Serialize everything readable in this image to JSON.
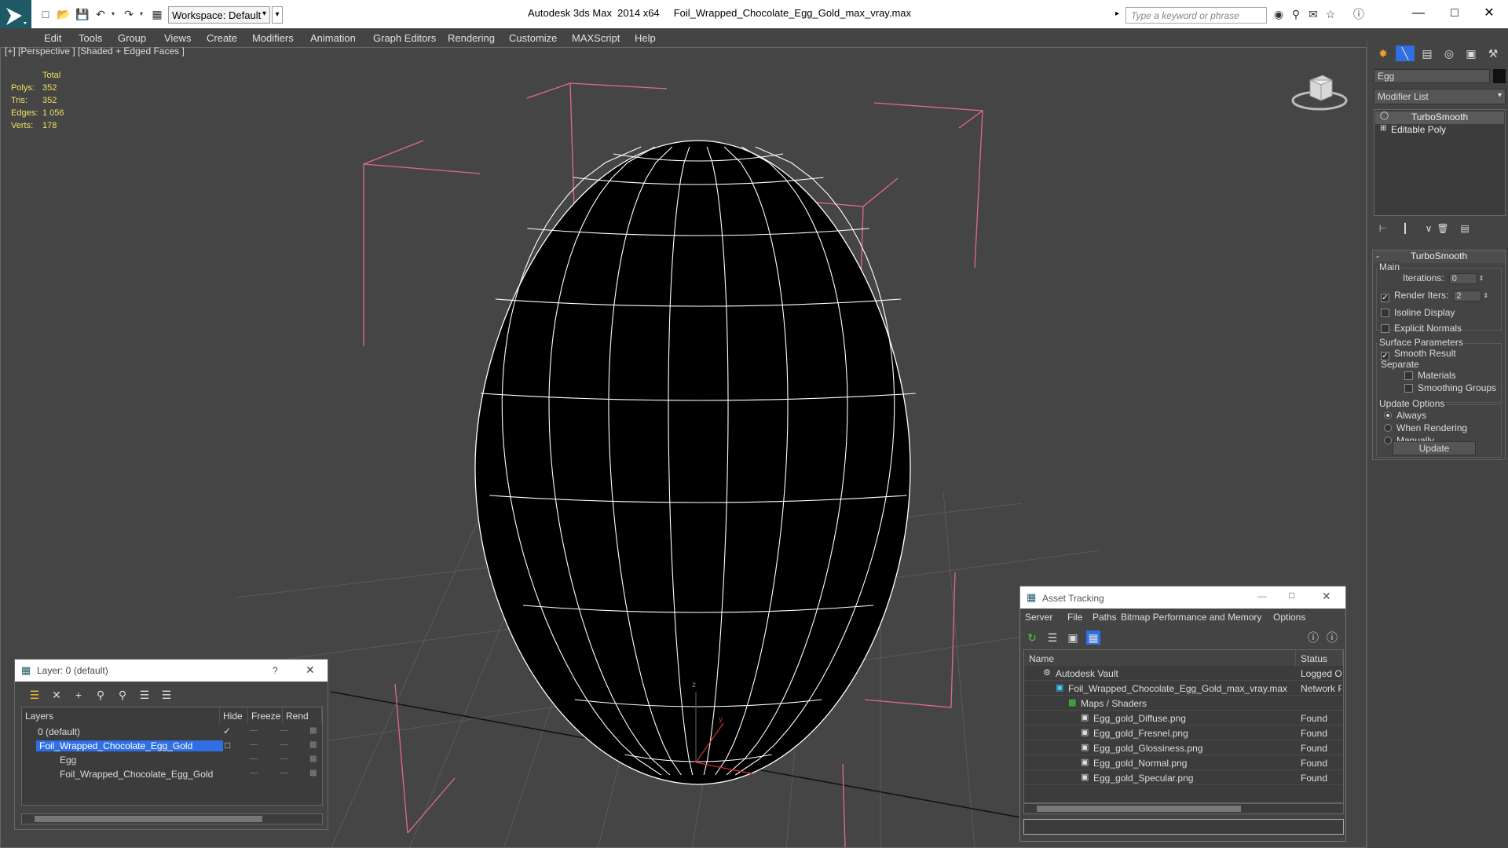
{
  "app": {
    "title": "Autodesk 3ds Max  2014 x64     Foil_Wrapped_Chocolate_Egg_Gold_max_vray.max",
    "workspace": "Workspace: Default",
    "search_placeholder": "Type a keyword or phrase"
  },
  "menu": [
    "Edit",
    "Tools",
    "Group",
    "Views",
    "Create",
    "Modifiers",
    "Animation",
    "Graph Editors",
    "Rendering",
    "Customize",
    "MAXScript",
    "Help"
  ],
  "viewport": {
    "label": "[+] [Perspective ] [Shaded + Edged Faces ]",
    "stats": {
      "header": "Total",
      "polys_label": "Polys:",
      "polys": "352",
      "tris_label": "Tris:",
      "tris": "352",
      "edges_label": "Edges:",
      "edges": "1 056",
      "verts_label": "Verts:",
      "verts": "178"
    }
  },
  "command_panel": {
    "object_name": "Egg",
    "modifier_list": "Modifier List",
    "stack": [
      "TurboSmooth",
      "Editable Poly"
    ],
    "rollout_title": "TurboSmooth",
    "main_label": "Main",
    "iterations_label": "Iterations:",
    "iterations": "0",
    "render_iters_label": "Render Iters:",
    "render_iters": "2",
    "isoline": "Isoline Display",
    "explicit_normals": "Explicit Normals",
    "surface_params": "Surface Parameters",
    "smooth_result": "Smooth Result",
    "separate": "Separate",
    "materials": "Materials",
    "smoothing_groups": "Smoothing Groups",
    "update_options": "Update Options",
    "always": "Always",
    "when_rendering": "When Rendering",
    "manually": "Manually",
    "update_button": "Update"
  },
  "layer_dialog": {
    "title": "Layer: 0 (default)",
    "help": "?",
    "columns": [
      "Layers",
      "Hide",
      "Freeze",
      "Rend"
    ],
    "rows": [
      "0 (default)",
      "Foil_Wrapped_Chocolate_Egg_Gold",
      "Egg",
      "Foil_Wrapped_Chocolate_Egg_Gold"
    ]
  },
  "asset_tracking": {
    "title": "Asset Tracking",
    "menu": [
      "Server",
      "File",
      "Paths",
      "Bitmap Performance and Memory",
      "Options"
    ],
    "columns": [
      "Name",
      "Status"
    ],
    "rows": [
      {
        "name": "Autodesk Vault",
        "status": "Logged Ou"
      },
      {
        "name": "Foil_Wrapped_Chocolate_Egg_Gold_max_vray.max",
        "status": "Network Pa"
      },
      {
        "name": "Maps / Shaders",
        "status": ""
      },
      {
        "name": "Egg_gold_Diffuse.png",
        "status": "Found"
      },
      {
        "name": "Egg_gold_Fresnel.png",
        "status": "Found"
      },
      {
        "name": "Egg_gold_Glossiness.png",
        "status": "Found"
      },
      {
        "name": "Egg_gold_Normal.png",
        "status": "Found"
      },
      {
        "name": "Egg_gold_Specular.png",
        "status": "Found"
      }
    ]
  }
}
